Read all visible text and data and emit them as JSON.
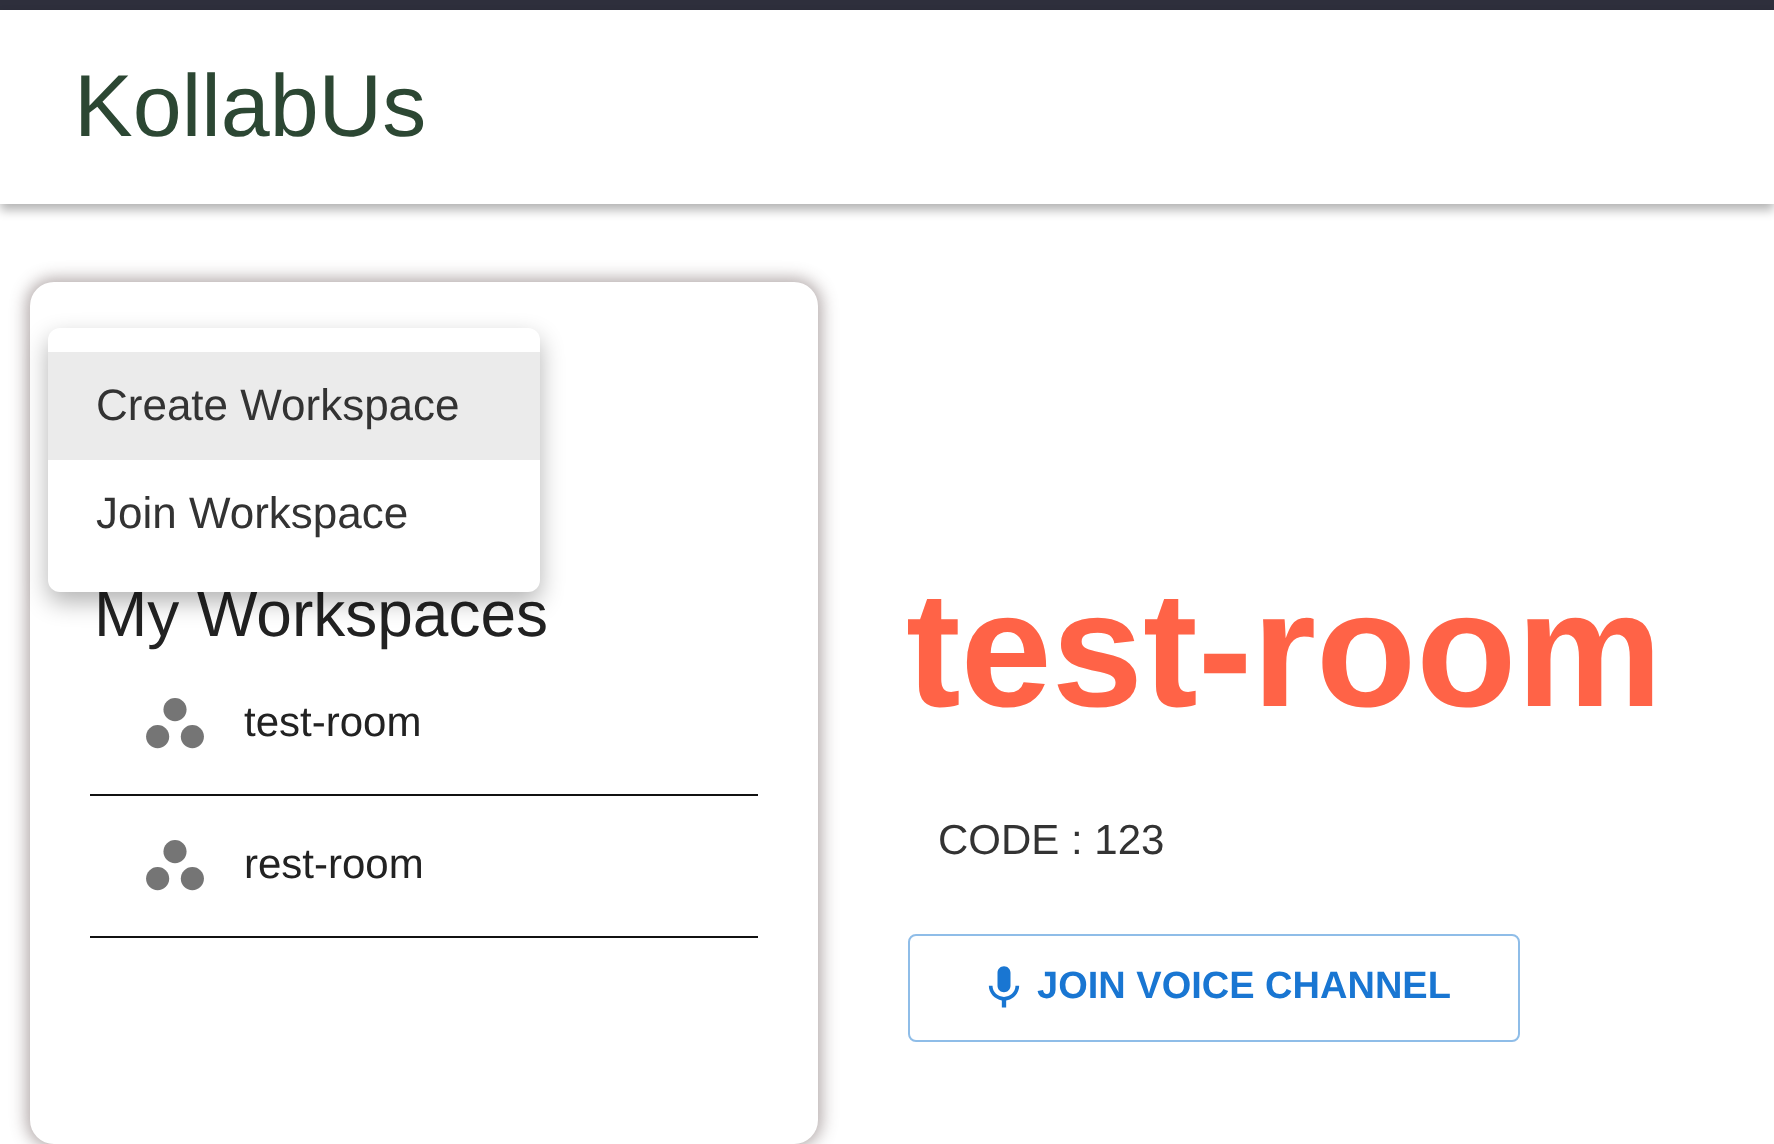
{
  "app_bar": {
    "title": "KollabUs"
  },
  "sidebar": {
    "heading": "My Workspaces",
    "workspaces": [
      {
        "name": "test-room"
      },
      {
        "name": "rest-room"
      }
    ]
  },
  "menu": {
    "items": [
      {
        "label": "Create Workspace",
        "selected": true
      },
      {
        "label": "Join Workspace",
        "selected": false
      }
    ]
  },
  "room": {
    "title": "test-room",
    "code": "CODE : 123",
    "voice_button": "JOIN VOICE CHANNEL"
  }
}
